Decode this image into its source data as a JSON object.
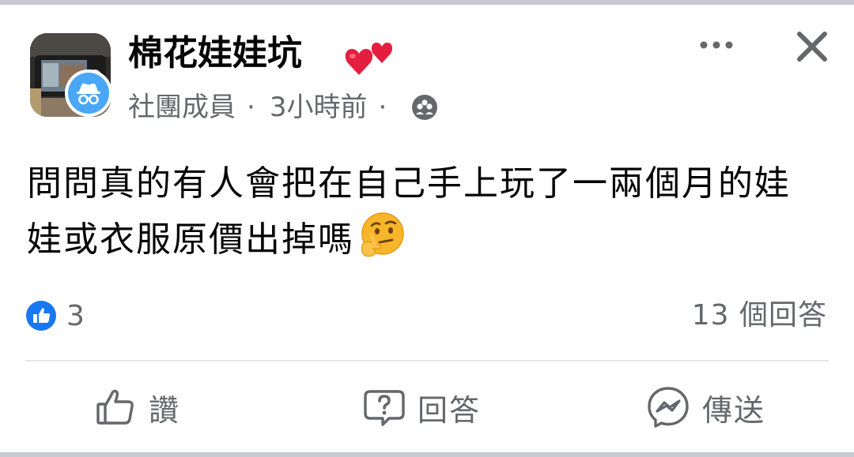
{
  "post": {
    "group_name": "棉花娃娃坑",
    "author_role": "社團成員",
    "time_ago": "3小時前",
    "separator": "·",
    "privacy_icon": "group-members-icon",
    "text": "問問真的有人會把在自己手上玩了一兩個月的娃娃或衣服原價出掉嗎",
    "emoji": "thinking-face"
  },
  "header_icons": {
    "more": "more-dots-icon",
    "close": "close-x-icon"
  },
  "reactions": {
    "type": "like",
    "count": "3"
  },
  "answers": {
    "label": "13 個回答"
  },
  "actions": [
    {
      "label": "讚",
      "icon": "thumbs-up-outline-icon"
    },
    {
      "label": "回答",
      "icon": "question-bubble-icon"
    },
    {
      "label": "傳送",
      "icon": "messenger-icon"
    }
  ],
  "colors": {
    "secondary_text": "#65676b",
    "like_blue": "#1877f2",
    "heart_red": "#e41e3f",
    "badge_bg": "#4aa7f5"
  }
}
